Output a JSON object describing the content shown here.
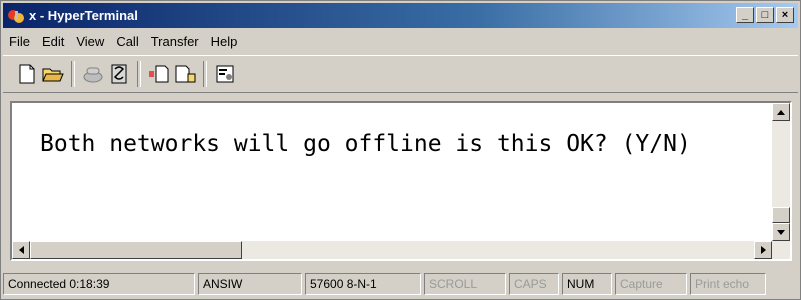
{
  "window": {
    "title": "x - HyperTerminal",
    "controls": {
      "minimize": "_",
      "maximize": "□",
      "close": "×"
    }
  },
  "menu": [
    {
      "label": "File"
    },
    {
      "label": "Edit"
    },
    {
      "label": "View"
    },
    {
      "label": "Call"
    },
    {
      "label": "Transfer"
    },
    {
      "label": "Help"
    }
  ],
  "toolbar": {
    "buttons": [
      "new-icon",
      "open-icon",
      "call-icon",
      "disconnect-icon",
      "send-icon",
      "receive-icon",
      "properties-icon"
    ]
  },
  "terminal": {
    "text": "Both networks will go offline is this OK? (Y/N)"
  },
  "status": {
    "connected": "Connected 0:18:39",
    "emulation": "ANSIW",
    "port": "57600 8-N-1",
    "scroll": "SCROLL",
    "caps": "CAPS",
    "num": "NUM",
    "capture": "Capture",
    "print_echo": "Print echo"
  }
}
